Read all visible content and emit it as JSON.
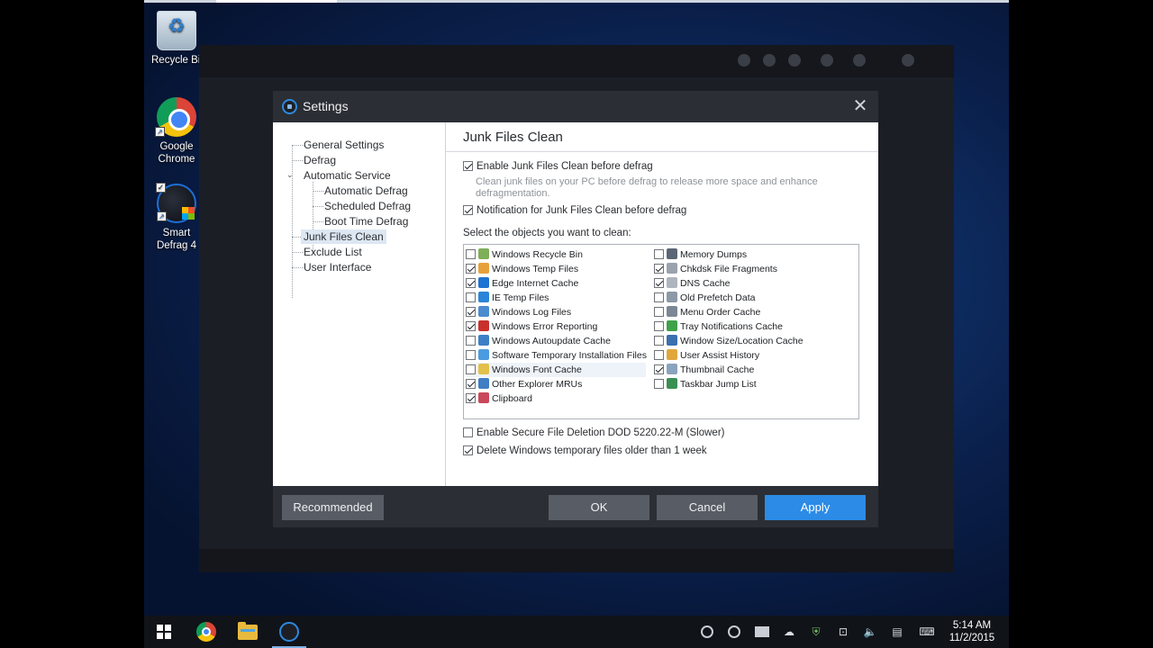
{
  "desktop": {
    "icons": [
      {
        "label": "Recycle Bin"
      },
      {
        "label": "Google Chrome"
      },
      {
        "label": "Smart Defrag 4"
      }
    ]
  },
  "dialog": {
    "title": "Settings",
    "close_glyph": "✕",
    "nav": {
      "general": "General Settings",
      "defrag": "Defrag",
      "automatic_service": "Automatic Service",
      "automatic_defrag": "Automatic Defrag",
      "scheduled_defrag": "Scheduled Defrag",
      "boot_time_defrag": "Boot Time Defrag",
      "junk_files_clean": "Junk Files Clean",
      "exclude_list": "Exclude List",
      "user_interface": "User Interface",
      "active": "junk_files_clean"
    },
    "panel": {
      "title": "Junk Files Clean",
      "enable_label": "Enable Junk Files Clean before defrag",
      "enable_checked": true,
      "enable_desc": "Clean junk files on your PC before defrag to release more space and enhance defragmentation.",
      "notify_label": "Notification for Junk Files Clean before defrag",
      "notify_checked": true,
      "objects_label": "Select the objects you want to clean:",
      "objects_left": [
        {
          "label": "Windows Recycle Bin",
          "checked": false,
          "icon": "recycle-bin-icon",
          "color": "#7fae5a"
        },
        {
          "label": "Windows Temp Files",
          "checked": true,
          "icon": "windows-icon",
          "color": "#e8a13a"
        },
        {
          "label": "Edge Internet Cache",
          "checked": true,
          "icon": "edge-icon",
          "color": "#1e73d2"
        },
        {
          "label": "IE Temp Files",
          "checked": false,
          "icon": "ie-icon",
          "color": "#2a85d8"
        },
        {
          "label": "Windows Log Files",
          "checked": true,
          "icon": "log-file-icon",
          "color": "#4a8ccf"
        },
        {
          "label": "Windows Error Reporting",
          "checked": true,
          "icon": "error-report-icon",
          "color": "#c9302c"
        },
        {
          "label": "Windows Autoupdate Cache",
          "checked": false,
          "icon": "update-icon",
          "color": "#3c7fc7"
        },
        {
          "label": "Software Temporary Installation Files",
          "checked": false,
          "icon": "installer-icon",
          "color": "#4b9be0"
        },
        {
          "label": "Windows Font Cache",
          "checked": false,
          "icon": "font-icon",
          "color": "#e3c04a"
        },
        {
          "label": "Other Explorer MRUs",
          "checked": true,
          "icon": "explorer-icon",
          "color": "#3f7ec4"
        },
        {
          "label": "Clipboard",
          "checked": true,
          "icon": "clipboard-icon",
          "color": "#c9485b"
        }
      ],
      "objects_right": [
        {
          "label": "Memory Dumps",
          "checked": false,
          "icon": "memory-icon",
          "color": "#5a6674"
        },
        {
          "label": "Chkdsk File Fragments",
          "checked": true,
          "icon": "disk-icon",
          "color": "#9aa3ad"
        },
        {
          "label": "DNS Cache",
          "checked": true,
          "icon": "dns-icon",
          "color": "#aeb5bd"
        },
        {
          "label": "Old Prefetch Data",
          "checked": false,
          "icon": "prefetch-icon",
          "color": "#8d99a6"
        },
        {
          "label": "Menu Order Cache",
          "checked": false,
          "icon": "menu-icon",
          "color": "#7b8794"
        },
        {
          "label": "Tray Notifications Cache",
          "checked": false,
          "icon": "tray-icon",
          "color": "#3fa24a"
        },
        {
          "label": "Window Size/Location Cache",
          "checked": false,
          "icon": "window-icon",
          "color": "#3a6fb0"
        },
        {
          "label": "User Assist History",
          "checked": false,
          "icon": "user-icon",
          "color": "#e0a73a"
        },
        {
          "label": "Thumbnail Cache",
          "checked": true,
          "icon": "thumbnail-icon",
          "color": "#8aa3bf"
        },
        {
          "label": "Taskbar Jump List",
          "checked": false,
          "icon": "taskbar-icon",
          "color": "#3b8f53"
        }
      ],
      "secure_label": "Enable Secure File Deletion DOD 5220.22-M (Slower)",
      "secure_checked": false,
      "older_label": "Delete Windows temporary files older than 1 week",
      "older_checked": true
    },
    "buttons": {
      "recommended": "Recommended",
      "ok": "OK",
      "cancel": "Cancel",
      "apply": "Apply"
    }
  },
  "taskbar": {
    "time": "5:14 AM",
    "date": "11/2/2015",
    "colors": {
      "accent": "#2b8be6"
    }
  }
}
